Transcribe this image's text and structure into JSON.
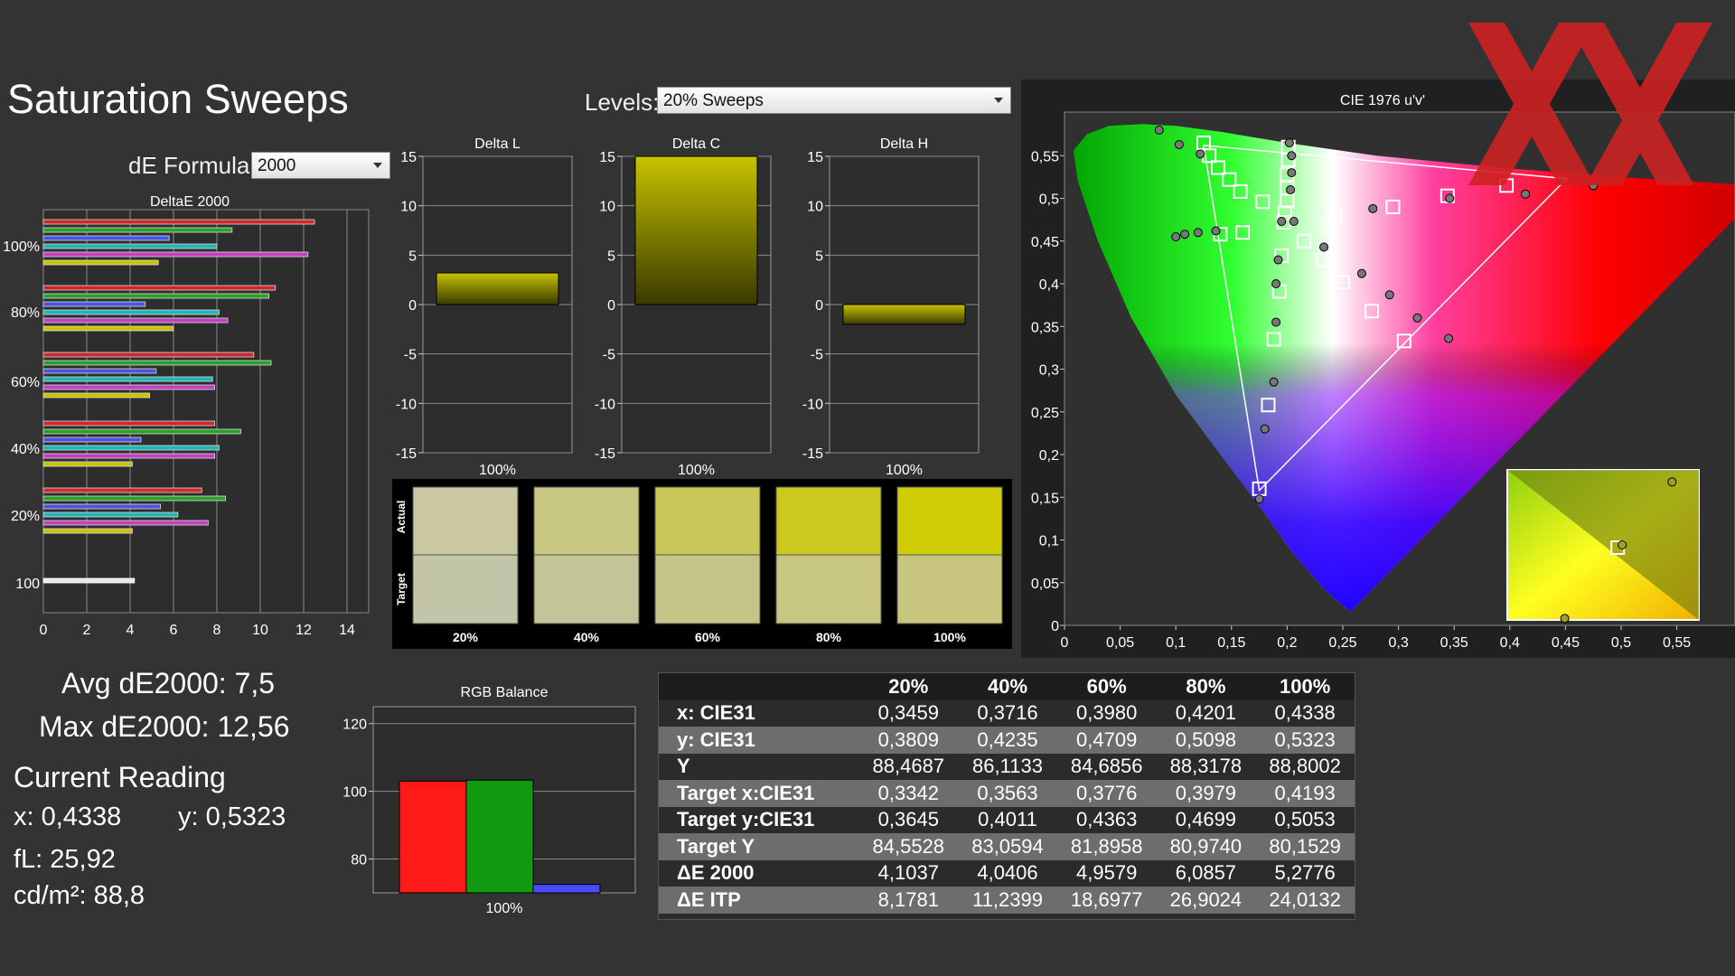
{
  "header": {
    "title": "Saturation Sweeps"
  },
  "levels": {
    "label": "Levels:",
    "value": "20% Sweeps"
  },
  "formula": {
    "label": "dE Formula:",
    "value": "2000"
  },
  "summary": {
    "avg": "Avg dE2000: 7,5",
    "max": "Max dE2000: 12,56",
    "current_title": "Current Reading",
    "x": "x: 0,4338",
    "y": "y: 0,5323",
    "fl": "fL: 25,92",
    "cdm2": "cd/m²: 88,8"
  },
  "colors": {
    "accent": "#c7c300",
    "red": "#ff1a1a",
    "green": "#0f9a0f",
    "blue": "#4a4aff",
    "watermark": "#cc2222"
  },
  "chart_data": [
    {
      "type": "bar",
      "orientation": "horizontal",
      "title": "DeltaE 2000",
      "categories": [
        "100%",
        "80%",
        "60%",
        "40%",
        "20%",
        "100"
      ],
      "xlim": [
        0,
        15
      ],
      "xticks": [
        "0",
        "2",
        "4",
        "6",
        "8",
        "10",
        "12",
        "14"
      ],
      "series": [
        {
          "color": "#cc2a2a",
          "values": [
            12.5,
            10.7,
            9.7,
            7.9,
            7.3
          ]
        },
        {
          "color": "#2aa02a",
          "values": [
            8.7,
            10.4,
            10.5,
            9.1,
            8.4
          ]
        },
        {
          "color": "#4a55dd",
          "values": [
            5.8,
            4.7,
            5.2,
            4.5,
            5.4
          ]
        },
        {
          "color": "#22b5b5",
          "values": [
            8.0,
            8.1,
            7.8,
            8.1,
            6.2
          ]
        },
        {
          "color": "#c040c0",
          "values": [
            12.2,
            8.5,
            7.9,
            7.9,
            7.6
          ]
        },
        {
          "color": "#c7c300",
          "values": [
            5.3,
            6.0,
            4.9,
            4.1,
            4.1
          ]
        }
      ],
      "white_value": 4.2
    },
    {
      "type": "bar",
      "title": "Delta L",
      "ylim": [
        -15,
        15
      ],
      "yticks": [
        "15",
        "10",
        "5",
        "0",
        "-5",
        "-10",
        "-15"
      ],
      "categories": [
        "100%"
      ],
      "values": [
        3.2
      ]
    },
    {
      "type": "bar",
      "title": "Delta C",
      "ylim": [
        -15,
        15
      ],
      "yticks": [
        "15",
        "10",
        "5",
        "0",
        "-5",
        "-10",
        "-15"
      ],
      "categories": [
        "100%"
      ],
      "values": [
        15
      ]
    },
    {
      "type": "bar",
      "title": "Delta H",
      "ylim": [
        -15,
        15
      ],
      "yticks": [
        "15",
        "10",
        "5",
        "0",
        "-5",
        "-10",
        "-15"
      ],
      "categories": [
        "100%"
      ],
      "values": [
        -2
      ]
    },
    {
      "type": "swatches",
      "row_labels": [
        "Actual",
        "Target"
      ],
      "labels": [
        "20%",
        "40%",
        "60%",
        "80%",
        "100%"
      ],
      "actual": [
        "#c9c8a2",
        "#c9c882",
        "#cac858",
        "#ccc91e",
        "#d0cd06"
      ],
      "target": [
        "#c3c5a8",
        "#c3c497",
        "#c6c587",
        "#c7c682",
        "#c8c67e"
      ]
    },
    {
      "type": "bar",
      "title": "RGB Balance",
      "ylim": [
        70,
        125
      ],
      "yticks": [
        "120",
        "100",
        "80"
      ],
      "categories": [
        "100%"
      ],
      "series": [
        {
          "color": "#ff1a1a",
          "value": 103
        },
        {
          "color": "#0f9a0f",
          "value": 103.3
        },
        {
          "color": "#4a4aff",
          "value": 72.5
        }
      ]
    },
    {
      "type": "scatter",
      "title": "CIE 1976 u'v'",
      "xlim": [
        0,
        0.6
      ],
      "ylim": [
        0,
        0.6
      ],
      "xticks": [
        "0",
        "0,05",
        "0,1",
        "0,15",
        "0,2",
        "0,25",
        "0,3",
        "0,35",
        "0,4",
        "0,45",
        "0,5",
        "0,55"
      ],
      "yticks": [
        "0",
        "0,05",
        "0,1",
        "0,15",
        "0,2",
        "0,25",
        "0,3",
        "0,35",
        "0,4",
        "0,45",
        "0,5",
        "0,55"
      ],
      "targets": [
        [
          0.125,
          0.565
        ],
        [
          0.13,
          0.55
        ],
        [
          0.138,
          0.536
        ],
        [
          0.148,
          0.522
        ],
        [
          0.158,
          0.508
        ],
        [
          0.178,
          0.496
        ],
        [
          0.198,
          0.483
        ],
        [
          0.201,
          0.56
        ],
        [
          0.201,
          0.545
        ],
        [
          0.2,
          0.528
        ],
        [
          0.2,
          0.512
        ],
        [
          0.2,
          0.497
        ],
        [
          0.197,
          0.472
        ],
        [
          0.195,
          0.433
        ],
        [
          0.193,
          0.391
        ],
        [
          0.188,
          0.335
        ],
        [
          0.183,
          0.258
        ],
        [
          0.175,
          0.16
        ],
        [
          0.16,
          0.46
        ],
        [
          0.14,
          0.458
        ],
        [
          0.215,
          0.45
        ],
        [
          0.232,
          0.428
        ],
        [
          0.25,
          0.402
        ],
        [
          0.276,
          0.368
        ],
        [
          0.305,
          0.333
        ],
        [
          0.243,
          0.48
        ],
        [
          0.295,
          0.49
        ],
        [
          0.344,
          0.503
        ],
        [
          0.397,
          0.515
        ]
      ],
      "measured": [
        [
          0.085,
          0.58
        ],
        [
          0.103,
          0.563
        ],
        [
          0.122,
          0.552
        ],
        [
          0.202,
          0.565
        ],
        [
          0.204,
          0.55
        ],
        [
          0.204,
          0.53
        ],
        [
          0.203,
          0.51
        ],
        [
          0.1,
          0.455
        ],
        [
          0.108,
          0.458
        ],
        [
          0.12,
          0.46
        ],
        [
          0.136,
          0.462
        ],
        [
          0.206,
          0.473
        ],
        [
          0.233,
          0.443
        ],
        [
          0.267,
          0.412
        ],
        [
          0.292,
          0.387
        ],
        [
          0.317,
          0.36
        ],
        [
          0.345,
          0.336
        ],
        [
          0.277,
          0.488
        ],
        [
          0.346,
          0.5
        ],
        [
          0.414,
          0.505
        ],
        [
          0.475,
          0.515
        ],
        [
          0.192,
          0.428
        ],
        [
          0.19,
          0.4
        ],
        [
          0.19,
          0.355
        ],
        [
          0.188,
          0.285
        ],
        [
          0.18,
          0.23
        ],
        [
          0.175,
          0.148
        ],
        [
          0.195,
          0.473
        ]
      ],
      "inset_points": [
        [
          0.86,
          0.08
        ],
        [
          0.6,
          0.5
        ],
        [
          0.3,
          0.99
        ]
      ]
    },
    {
      "type": "table",
      "columns": [
        "",
        "20%",
        "40%",
        "60%",
        "80%",
        "100%"
      ],
      "rows": [
        {
          "label": "x: CIE31",
          "values": [
            "0,3459",
            "0,3716",
            "0,3980",
            "0,4201",
            "0,4338"
          ]
        },
        {
          "label": "y: CIE31",
          "values": [
            "0,3809",
            "0,4235",
            "0,4709",
            "0,5098",
            "0,5323"
          ]
        },
        {
          "label": "Y",
          "values": [
            "88,4687",
            "86,1133",
            "84,6856",
            "88,3178",
            "88,8002"
          ]
        },
        {
          "label": "Target x:CIE31",
          "values": [
            "0,3342",
            "0,3563",
            "0,3776",
            "0,3979",
            "0,4193"
          ]
        },
        {
          "label": "Target y:CIE31",
          "values": [
            "0,3645",
            "0,4011",
            "0,4363",
            "0,4699",
            "0,5053"
          ]
        },
        {
          "label": "Target Y",
          "values": [
            "84,5528",
            "83,0594",
            "81,8958",
            "80,9740",
            "80,1529"
          ]
        },
        {
          "label": "ΔE 2000",
          "values": [
            "4,1037",
            "4,0406",
            "4,9579",
            "6,0857",
            "5,2776"
          ]
        },
        {
          "label": "ΔE ITP",
          "values": [
            "8,1781",
            "11,2399",
            "18,6977",
            "26,9024",
            "24,0132"
          ]
        }
      ]
    }
  ]
}
